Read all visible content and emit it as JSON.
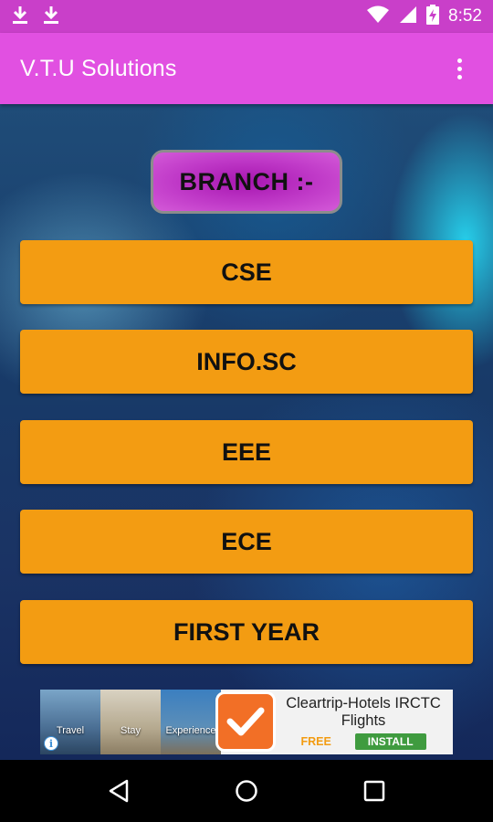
{
  "status_bar": {
    "time": "8:52",
    "left_icons": [
      "download-icon",
      "download-icon"
    ],
    "right_icons": [
      "wifi-icon",
      "signal-icon",
      "battery-charging-icon"
    ]
  },
  "app_bar": {
    "title": "V.T.U Solutions",
    "menu_icon": "overflow-menu-icon"
  },
  "content": {
    "heading": "BRANCH :-",
    "branches": [
      {
        "label": "CSE"
      },
      {
        "label": "INFO.SC"
      },
      {
        "label": "EEE"
      },
      {
        "label": "ECE"
      },
      {
        "label": "FIRST YEAR"
      }
    ]
  },
  "ad": {
    "tiles": [
      "Travel",
      "Stay",
      "Experience"
    ],
    "title": "Cleartrip-Hotels IRCTC Flights",
    "price": "FREE",
    "cta": "INSTALL"
  },
  "nav_bar": {
    "icons": [
      "back-icon",
      "home-icon",
      "recents-icon"
    ]
  },
  "colors": {
    "status_bar": "#c93fc9",
    "app_bar": "#e150e1",
    "button": "#f39c12",
    "install": "#3f9b3f"
  }
}
